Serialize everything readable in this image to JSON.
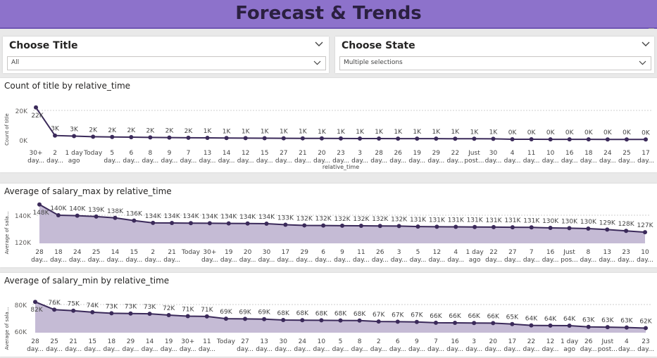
{
  "header": {
    "title": "Forecast & Trends"
  },
  "filters": [
    {
      "label": "Choose Title",
      "value": "All"
    },
    {
      "label": "Choose State",
      "value": "Multiple selections"
    }
  ],
  "colors": {
    "accent": "#8d72cb",
    "line": "#3b2a5a",
    "fill": "#b1a4c7"
  },
  "chart_data": [
    {
      "type": "line",
      "title": "Count of title by relative_time",
      "xlabel": "relative_time",
      "ylabel": "Count of title",
      "yticks": [
        "20K",
        "0K"
      ],
      "ylim": [
        0,
        20000
      ],
      "grid": true,
      "categories": [
        [
          "30+",
          "day..."
        ],
        [
          "2",
          "day..."
        ],
        [
          "1 day",
          "ago"
        ],
        [
          "Today"
        ],
        [
          "5",
          "day..."
        ],
        [
          "6",
          "day..."
        ],
        [
          "8",
          "day..."
        ],
        [
          "9",
          "day..."
        ],
        [
          "7",
          "day..."
        ],
        [
          "13",
          "day..."
        ],
        [
          "14",
          "day..."
        ],
        [
          "12",
          "day..."
        ],
        [
          "15",
          "day..."
        ],
        [
          "27",
          "day..."
        ],
        [
          "21",
          "day..."
        ],
        [
          "20",
          "day..."
        ],
        [
          "23",
          "day..."
        ],
        [
          "3",
          "day..."
        ],
        [
          "28",
          "day..."
        ],
        [
          "26",
          "day..."
        ],
        [
          "19",
          "day..."
        ],
        [
          "29",
          "day..."
        ],
        [
          "22",
          "day..."
        ],
        [
          "Just",
          "post..."
        ],
        [
          "30",
          "day..."
        ],
        [
          "4",
          "day..."
        ],
        [
          "11",
          "day..."
        ],
        [
          "10",
          "day..."
        ],
        [
          "16",
          "day..."
        ],
        [
          "18",
          "day..."
        ],
        [
          "24",
          "day..."
        ],
        [
          "25",
          "day..."
        ],
        [
          "17",
          "day..."
        ]
      ],
      "labels": [
        "22K",
        "3K",
        "3K",
        "2K",
        "2K",
        "2K",
        "2K",
        "2K",
        "2K",
        "1K",
        "1K",
        "1K",
        "1K",
        "1K",
        "1K",
        "1K",
        "1K",
        "1K",
        "1K",
        "1K",
        "1K",
        "1K",
        "1K",
        "1K",
        "1K",
        "0K",
        "0K",
        "0K",
        "0K",
        "0K",
        "0K",
        "0K",
        "0K"
      ],
      "values": [
        22000,
        3000,
        2600,
        2200,
        2000,
        1900,
        1700,
        1600,
        1500,
        1400,
        1300,
        1250,
        1200,
        1150,
        1100,
        1050,
        1000,
        980,
        950,
        920,
        900,
        870,
        850,
        820,
        800,
        480,
        460,
        440,
        420,
        400,
        380,
        360,
        340
      ]
    },
    {
      "type": "area",
      "title": "Average of salary_max by relative_time",
      "xlabel": "",
      "ylabel": "Average of sala...",
      "yticks": [
        "140K",
        "120K"
      ],
      "ylim": [
        120000,
        140000
      ],
      "grid": true,
      "categories": [
        [
          "28",
          "day..."
        ],
        [
          "18",
          "day..."
        ],
        [
          "24",
          "day..."
        ],
        [
          "25",
          "day..."
        ],
        [
          "14",
          "day..."
        ],
        [
          "15",
          "day..."
        ],
        [
          "2",
          "day..."
        ],
        [
          "21",
          "day..."
        ],
        [
          "Today"
        ],
        [
          "30+",
          "day..."
        ],
        [
          "19",
          "day..."
        ],
        [
          "20",
          "day..."
        ],
        [
          "30",
          "day..."
        ],
        [
          "17",
          "day..."
        ],
        [
          "29",
          "day..."
        ],
        [
          "6",
          "day..."
        ],
        [
          "9",
          "day..."
        ],
        [
          "11",
          "day..."
        ],
        [
          "26",
          "day..."
        ],
        [
          "3",
          "day..."
        ],
        [
          "5",
          "day..."
        ],
        [
          "12",
          "day..."
        ],
        [
          "4",
          "day..."
        ],
        [
          "1 day",
          "ago"
        ],
        [
          "22",
          "day..."
        ],
        [
          "27",
          "day..."
        ],
        [
          "7",
          "day..."
        ],
        [
          "16",
          "day..."
        ],
        [
          "Just",
          "pos..."
        ],
        [
          "8",
          "day..."
        ],
        [
          "13",
          "day..."
        ],
        [
          "23",
          "day..."
        ],
        [
          "10",
          "day..."
        ]
      ],
      "labels": [
        "148K",
        "140K",
        "140K",
        "139K",
        "138K",
        "136K",
        "134K",
        "134K",
        "134K",
        "134K",
        "134K",
        "134K",
        "134K",
        "133K",
        "132K",
        "132K",
        "132K",
        "132K",
        "132K",
        "132K",
        "131K",
        "131K",
        "131K",
        "131K",
        "131K",
        "131K",
        "131K",
        "130K",
        "130K",
        "130K",
        "129K",
        "128K",
        "127K"
      ],
      "values": [
        148000,
        140000,
        139700,
        139000,
        138000,
        136000,
        134300,
        134200,
        134100,
        134000,
        133900,
        133800,
        133700,
        132900,
        132400,
        132300,
        132200,
        132100,
        132000,
        131900,
        131500,
        131400,
        131300,
        131200,
        131100,
        131000,
        130900,
        130500,
        130300,
        130000,
        129300,
        128300,
        127300
      ]
    },
    {
      "type": "area",
      "title": "Average of salary_min by relative_time",
      "xlabel": "",
      "ylabel": "Average of sala...",
      "yticks": [
        "80K",
        "60K"
      ],
      "ylim": [
        60000,
        80000
      ],
      "grid": true,
      "categories": [
        [
          "28",
          "day..."
        ],
        [
          "25",
          "day..."
        ],
        [
          "21",
          "day..."
        ],
        [
          "15",
          "day..."
        ],
        [
          "18",
          "day..."
        ],
        [
          "29",
          "day..."
        ],
        [
          "14",
          "day..."
        ],
        [
          "19",
          "day..."
        ],
        [
          "30+",
          "day..."
        ],
        [
          "11",
          "day..."
        ],
        [
          "Today"
        ],
        [
          "27",
          "day..."
        ],
        [
          "13",
          "day..."
        ],
        [
          "30",
          "day..."
        ],
        [
          "24",
          "day..."
        ],
        [
          "10",
          "day..."
        ],
        [
          "5",
          "day..."
        ],
        [
          "8",
          "day..."
        ],
        [
          "2",
          "day..."
        ],
        [
          "6",
          "day..."
        ],
        [
          "9",
          "day..."
        ],
        [
          "7",
          "day..."
        ],
        [
          "16",
          "day..."
        ],
        [
          "3",
          "day..."
        ],
        [
          "20",
          "day..."
        ],
        [
          "17",
          "day..."
        ],
        [
          "22",
          "day..."
        ],
        [
          "12",
          "day..."
        ],
        [
          "1 day",
          "ago"
        ],
        [
          "26",
          "day..."
        ],
        [
          "Just",
          "post..."
        ],
        [
          "4",
          "day..."
        ],
        [
          "23",
          "day..."
        ]
      ],
      "labels": [
        "82K",
        "76K",
        "75K",
        "74K",
        "73K",
        "73K",
        "73K",
        "72K",
        "71K",
        "71K",
        "69K",
        "69K",
        "69K",
        "68K",
        "68K",
        "68K",
        "68K",
        "68K",
        "67K",
        "67K",
        "67K",
        "66K",
        "66K",
        "66K",
        "66K",
        "65K",
        "64K",
        "64K",
        "64K",
        "63K",
        "63K",
        "63K",
        "62K"
      ],
      "values": [
        82000,
        76200,
        75400,
        74300,
        73500,
        73300,
        73100,
        72100,
        71300,
        71100,
        69400,
        69300,
        69100,
        68400,
        68300,
        68200,
        68100,
        68000,
        67300,
        67200,
        67000,
        66400,
        66300,
        66200,
        66100,
        65400,
        64400,
        64300,
        64200,
        63300,
        63100,
        62800,
        62400
      ]
    }
  ]
}
